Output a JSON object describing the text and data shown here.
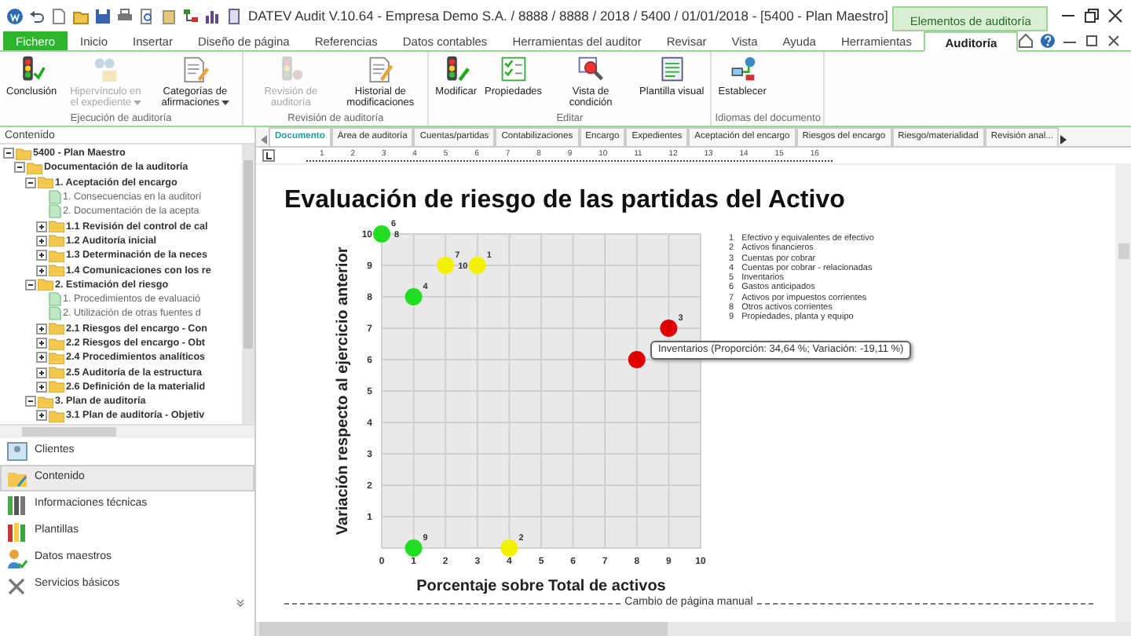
{
  "window": {
    "title": "DATEV Audit V.10.64 - Empresa Demo S.A. / 8888 / 8888 / 2018 / 5400 / 01/01/2018  - [5400 - Plan Maestro]",
    "context_group": "Elementos de auditoría"
  },
  "menu_tabs": [
    {
      "label": "Fichero",
      "kind": "file",
      "selected": false
    },
    {
      "label": "Inicio",
      "kind": "tab",
      "selected": false
    },
    {
      "label": "Insertar",
      "kind": "tab",
      "selected": false
    },
    {
      "label": "Diseño de página",
      "kind": "tab",
      "selected": false
    },
    {
      "label": "Referencias",
      "kind": "tab",
      "selected": false
    },
    {
      "label": "Datos contables",
      "kind": "tab",
      "selected": false
    },
    {
      "label": "Herramientas del auditor",
      "kind": "tab",
      "selected": false
    },
    {
      "label": "Revisar",
      "kind": "tab",
      "selected": false
    },
    {
      "label": "Vista",
      "kind": "tab",
      "selected": false
    },
    {
      "label": "Ayuda",
      "kind": "tab",
      "selected": false
    },
    {
      "label": "Herramientas",
      "kind": "tab",
      "selected": false
    },
    {
      "label": "Auditoría",
      "kind": "context",
      "selected": true
    }
  ],
  "ribbon": [
    {
      "label": "Ejecución de auditoría",
      "buttons": [
        {
          "label": "Conclusión",
          "disabled": false,
          "dropdown": false
        },
        {
          "label": "Hipervínculo en el expediente",
          "disabled": true,
          "dropdown": true
        },
        {
          "label": "Categorías de afirmaciones",
          "disabled": false,
          "dropdown": true
        }
      ]
    },
    {
      "label": "Revisión de auditoría",
      "buttons": [
        {
          "label": "Revisión de auditoría",
          "disabled": true,
          "dropdown": false
        },
        {
          "label": "Historial de modificaciones",
          "disabled": false,
          "dropdown": false
        }
      ]
    },
    {
      "label": "Editar",
      "buttons": [
        {
          "label": "Modificar",
          "disabled": false,
          "dropdown": false
        },
        {
          "label": "Propiedades",
          "disabled": false,
          "dropdown": false
        },
        {
          "label": "Vista de condición",
          "disabled": false,
          "dropdown": false
        },
        {
          "label": "Plantilla visual",
          "disabled": false,
          "dropdown": false
        }
      ]
    },
    {
      "label": "Idiomas del documento",
      "buttons": [
        {
          "label": "Establecer",
          "disabled": false,
          "dropdown": false
        }
      ]
    }
  ],
  "navigation_panel": {
    "title": "Contenido",
    "tree": [
      {
        "label": "5400 - Plan Maestro",
        "kind": "folder",
        "expanded": true,
        "children": [
          {
            "label": "Documentación de la auditoría",
            "kind": "folder",
            "expanded": true,
            "children": [
              {
                "label": "1. Aceptación del encargo",
                "kind": "folder",
                "expanded": true,
                "children": [
                  {
                    "label": "1. Consecuencias en la auditorí",
                    "kind": "document"
                  },
                  {
                    "label": "2. Documentación de la acepta",
                    "kind": "document"
                  },
                  {
                    "label": "1.1 Revisión del control de cal",
                    "kind": "folder",
                    "expanded": false
                  },
                  {
                    "label": "1.2 Auditoría inicial",
                    "kind": "folder",
                    "expanded": false
                  },
                  {
                    "label": "1.3 Determinación de la neces",
                    "kind": "folder",
                    "expanded": false
                  },
                  {
                    "label": "1.4 Comunicaciones con los re",
                    "kind": "folder",
                    "expanded": false
                  }
                ]
              },
              {
                "label": "2. Estimación del riesgo",
                "kind": "folder",
                "expanded": true,
                "children": [
                  {
                    "label": "1. Procedimientos de evaluació",
                    "kind": "document"
                  },
                  {
                    "label": "2. Utilización de otras fuentes d",
                    "kind": "document"
                  },
                  {
                    "label": "2.1 Riesgos del encargo - Con",
                    "kind": "folder",
                    "expanded": false
                  },
                  {
                    "label": "2.2 Riesgos del encargo - Obt",
                    "kind": "folder",
                    "expanded": false
                  },
                  {
                    "label": "2.4 Procedimientos analíticos",
                    "kind": "folder",
                    "expanded": false
                  },
                  {
                    "label": "2.5 Auditoría de la estructura",
                    "kind": "folder",
                    "expanded": false
                  },
                  {
                    "label": "2.6 Definición de la materialid",
                    "kind": "folder",
                    "expanded": false
                  }
                ]
              },
              {
                "label": "3. Plan de auditoría",
                "kind": "folder",
                "expanded": true,
                "children": [
                  {
                    "label": "3.1 Plan de auditoría - Objetiv",
                    "kind": "folder",
                    "expanded": false
                  }
                ]
              }
            ]
          }
        ]
      }
    ],
    "buttons": [
      {
        "label": "Clientes",
        "selected": false
      },
      {
        "label": "Contenido",
        "selected": true
      },
      {
        "label": "Informaciones técnicas",
        "selected": false
      },
      {
        "label": "Plantillas",
        "selected": false
      },
      {
        "label": "Datos maestros",
        "selected": false
      },
      {
        "label": "Servicios básicos",
        "selected": false
      }
    ]
  },
  "document_tabs": [
    {
      "label": "Documento",
      "selected": true
    },
    {
      "label": "Área de auditoría",
      "selected": false
    },
    {
      "label": "Cuentas/partidas",
      "selected": false
    },
    {
      "label": "Contabilizaciones",
      "selected": false
    },
    {
      "label": "Encargo",
      "selected": false
    },
    {
      "label": "Expedientes",
      "selected": false
    },
    {
      "label": "Aceptación del encargo",
      "selected": false
    },
    {
      "label": "Riesgos del encargo",
      "selected": false
    },
    {
      "label": "Riesgo/materialidad",
      "selected": false
    },
    {
      "label": "Revisión anal...",
      "selected": false
    }
  ],
  "ruler": [
    "1",
    "2",
    "3",
    "4",
    "5",
    "6",
    "7",
    "8",
    "9",
    "10",
    "11",
    "12",
    "13",
    "14",
    "15",
    "16"
  ],
  "document": {
    "heading": "Evaluación de riesgo de las partidas del Activo",
    "chart_data": {
      "type": "scatter",
      "xlabel": "Porcentaje sobre Total de activos",
      "ylabel": "Variación respecto al ejercicio anterior",
      "xlim": [
        0,
        10
      ],
      "ylim": [
        0,
        10
      ],
      "xticks": [
        0,
        1,
        2,
        3,
        4,
        5,
        6,
        7,
        8,
        9,
        10
      ],
      "yticks": [
        1,
        2,
        3,
        4,
        5,
        6,
        7,
        8,
        9,
        10
      ],
      "series": [
        {
          "color": "#22dd22",
          "x": [
            0,
            1,
            1
          ],
          "values": [
            10,
            8,
            0
          ]
        },
        {
          "color": "#f2f200",
          "x": [
            2,
            3,
            4
          ],
          "values": [
            9,
            9,
            0
          ]
        },
        {
          "color": "#e00000",
          "x": [
            9,
            8
          ],
          "values": [
            7,
            6
          ]
        }
      ],
      "grid": true,
      "annotations": [
        {
          "x": 0,
          "y": 10,
          "text": "6"
        },
        {
          "x": 0,
          "y": 10,
          "text": "8"
        },
        {
          "x": 2,
          "y": 9,
          "text": "7"
        },
        {
          "x": 2,
          "y": 9,
          "text": "10"
        },
        {
          "x": 3,
          "y": 9,
          "text": "1"
        },
        {
          "x": 1,
          "y": 8,
          "text": "4"
        },
        {
          "x": 9,
          "y": 7,
          "text": "3"
        },
        {
          "x": 1,
          "y": 0,
          "text": "9"
        },
        {
          "x": 4,
          "y": 0,
          "text": "2"
        }
      ]
    },
    "legend": [
      {
        "number": "1",
        "label": "Efectivo y equivalentes de efectivo"
      },
      {
        "number": "2",
        "label": "Activos financieros"
      },
      {
        "number": "3",
        "label": "Cuentas por cobrar"
      },
      {
        "number": "4",
        "label": "Cuentas por cobrar - relacionadas"
      },
      {
        "number": "5",
        "label": "Inventarios"
      },
      {
        "number": "6",
        "label": "Gastos anticipados"
      },
      {
        "number": "7",
        "label": "Activos por impuestos corrientes"
      },
      {
        "number": "8",
        "label": "Otros activos corrientes"
      },
      {
        "number": "9",
        "label": "Propiedades, planta y equipo"
      }
    ],
    "tooltip": "Inventarios (Proporción: 34,64 %; Variación: -19,11 %)",
    "page_break": "Cambio de página manual"
  }
}
